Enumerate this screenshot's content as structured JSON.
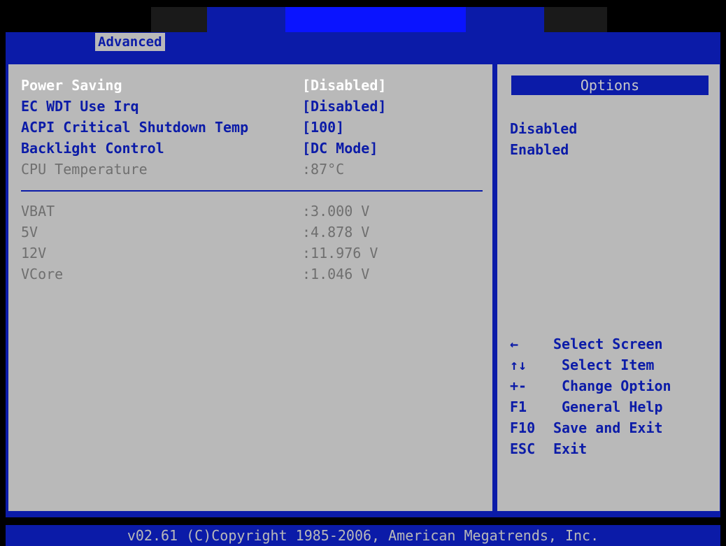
{
  "tabs": {
    "active": "Advanced"
  },
  "main": {
    "settings": [
      {
        "label": "Power Saving",
        "value": "[Disabled]"
      },
      {
        "label": "EC WDT Use Irq",
        "value": "[Disabled]"
      },
      {
        "label": "ACPI Critical Shutdown Temp",
        "value": "[100]"
      },
      {
        "label": "Backlight Control",
        "value": "[DC Mode]"
      }
    ],
    "cpu_temp": {
      "label": "CPU Temperature",
      "value": ":87°C"
    },
    "voltages": [
      {
        "label": "VBAT",
        "value": ":3.000 V"
      },
      {
        "label": "5V",
        "value": ":4.878 V"
      },
      {
        "label": "12V",
        "value": ":11.976 V"
      },
      {
        "label": "VCore",
        "value": ":1.046 V"
      }
    ]
  },
  "help": {
    "title": "Options",
    "options": [
      "Disabled",
      "Enabled"
    ],
    "keys": [
      {
        "key": "←",
        "action": "Select Screen"
      },
      {
        "key": "↑↓",
        "action": "Select Item"
      },
      {
        "key": "+-",
        "action": "Change Option"
      },
      {
        "key": "F1",
        "action": "General Help"
      },
      {
        "key": "F10",
        "action": "Save and Exit"
      },
      {
        "key": "ESC",
        "action": "Exit"
      }
    ]
  },
  "footer": {
    "text": "v02.61 (C)Copyright 1985-2006, American Megatrends, Inc."
  },
  "colors": {
    "background": "#b9b9b9",
    "accent": "#0b1ba8",
    "selected_text": "#ffffff",
    "disabled_text": "#6f6f6f"
  }
}
